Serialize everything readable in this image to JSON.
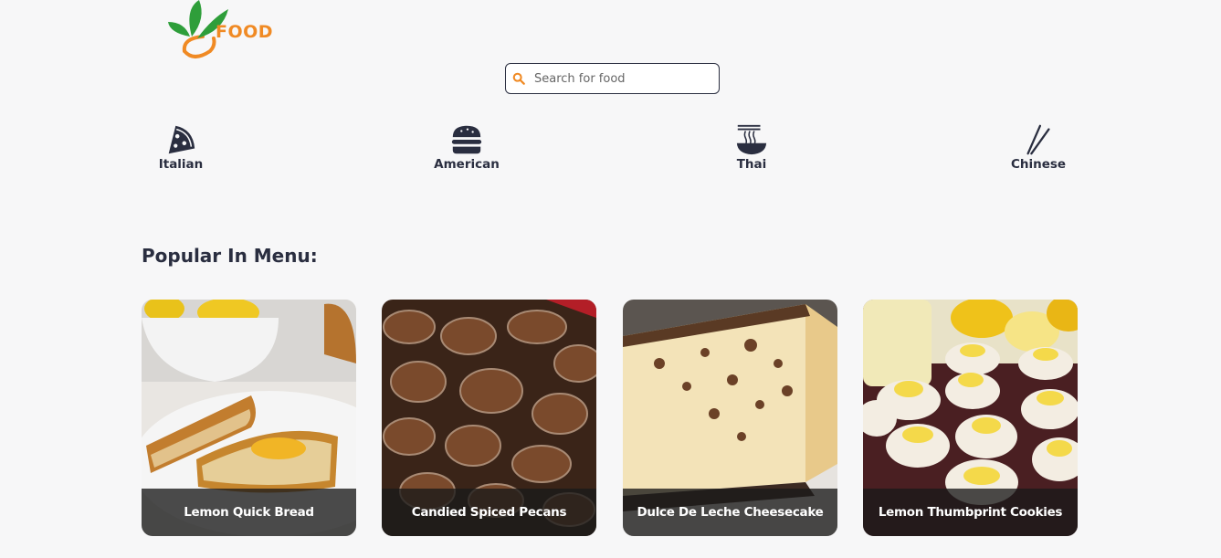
{
  "brand": {
    "logo_text": "FOOD",
    "accent": "#f08a24",
    "leaf": "#2e9e3a"
  },
  "search": {
    "placeholder": "Search for food",
    "icon": "search-icon"
  },
  "cuisines": [
    {
      "label": "Italian",
      "icon": "pizza-slice-icon"
    },
    {
      "label": "American",
      "icon": "burger-icon"
    },
    {
      "label": "Thai",
      "icon": "noodle-bowl-icon"
    },
    {
      "label": "Chinese",
      "icon": "chopsticks-icon"
    }
  ],
  "section": {
    "title": "Popular In Menu:"
  },
  "cards": [
    {
      "title": "Lemon Quick Bread"
    },
    {
      "title": "Candied Spiced Pecans"
    },
    {
      "title": "Dulce De Leche Cheesecake"
    },
    {
      "title": "Lemon Thumbprint Cookies"
    }
  ],
  "colors": {
    "text": "#2a2e40",
    "background": "#f7f7f8"
  }
}
